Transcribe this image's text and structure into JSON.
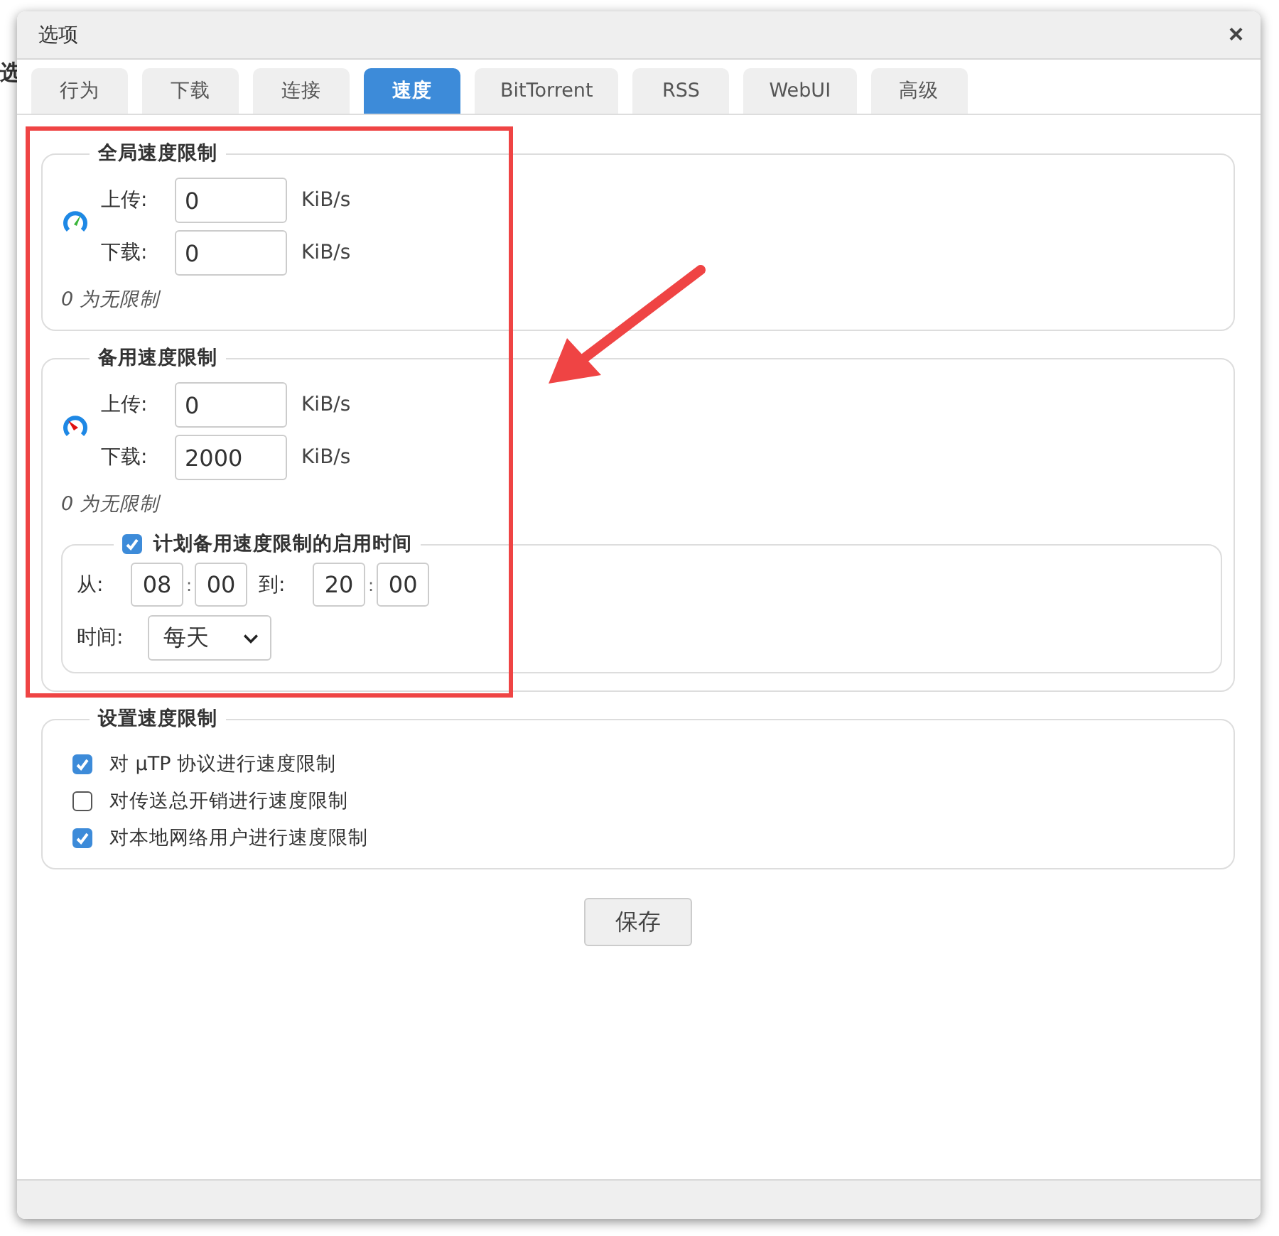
{
  "background": {
    "left_text": "选"
  },
  "window": {
    "title": "选项",
    "close": "×"
  },
  "tabs": [
    {
      "label": "行为",
      "selected": false
    },
    {
      "label": "下载",
      "selected": false
    },
    {
      "label": "连接",
      "selected": false
    },
    {
      "label": "速度",
      "selected": true
    },
    {
      "label": "BitTorrent",
      "selected": false
    },
    {
      "label": "RSS",
      "selected": false
    },
    {
      "label": "WebUI",
      "selected": false
    },
    {
      "label": "高级",
      "selected": false
    }
  ],
  "global_limits": {
    "title": "全局速度限制",
    "kind": "normal",
    "fields": [
      {
        "label": "上传:",
        "value": "0",
        "unit": "KiB/s"
      },
      {
        "label": "下载:",
        "value": "0",
        "unit": "KiB/s"
      }
    ],
    "note": "0 为无限制"
  },
  "alt_limits": {
    "title": "备用速度限制",
    "kind": "alternative",
    "fields": [
      {
        "label": "上传:",
        "value": "0",
        "unit": "KiB/s"
      },
      {
        "label": "下载:",
        "value": "2000",
        "unit": "KiB/s"
      }
    ],
    "note": "0 为无限制",
    "schedule": {
      "label": "计划备用速度限制的启用时间",
      "checked": true,
      "from_label": "从:",
      "from_hour": "08",
      "from_minute": "00",
      "to_label": "到:",
      "to_hour": "20",
      "to_minute": "00",
      "separator": ":",
      "days_label": "时间:",
      "days_value": "每天"
    }
  },
  "rate_settings": {
    "title": "设置速度限制",
    "options": [
      {
        "label": "对 µTP 协议进行速度限制",
        "checked": true
      },
      {
        "label": "对传送总开销进行速度限制",
        "checked": false
      },
      {
        "label": "对本地网络用户进行速度限制",
        "checked": true
      }
    ]
  },
  "save_button": "保存"
}
